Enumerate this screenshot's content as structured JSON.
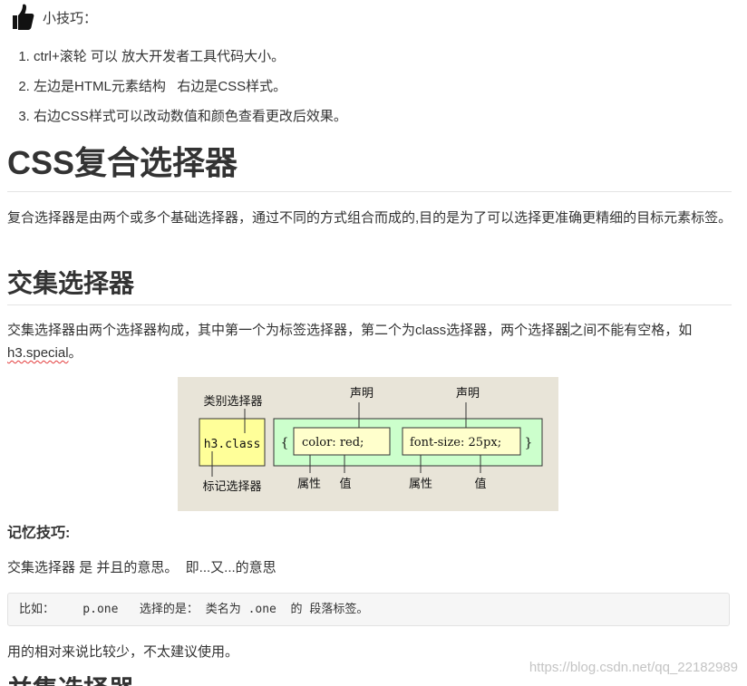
{
  "tip": {
    "icon": "thumbs-up-icon",
    "title": "小技巧："
  },
  "tips_list": [
    "ctrl+滚轮 可以 放大开发者工具代码大小。",
    "左边是HTML元素结构   右边是CSS样式。",
    "右边CSS样式可以改动数值和颜色查看更改后效果。"
  ],
  "section": {
    "title": "CSS复合选择器",
    "intro": "复合选择器是由两个或多个基础选择器，通过不同的方式组合而成的,目的是为了可以选择更准确更精细的目标元素标签。"
  },
  "intersection": {
    "title": "交集选择器",
    "desc_part1": "交集选择器由两个选择器构成，其中第一个为标签选择器，第二个为class选择器，两个选择器",
    "desc_part2": "之间不能有空格，如",
    "desc_code": "h3.special",
    "desc_end": "。"
  },
  "diagram": {
    "class_selector_label": "类别选择器",
    "tag_selector_label": "标记选择器",
    "selector_text": "h3.class",
    "open_brace": "{",
    "close_brace": "}",
    "declaration1": "color: red;",
    "declaration2": "font-size: 25px;",
    "statement_label1": "声明",
    "statement_label2": "声明",
    "property_label1": "属性",
    "value_label1": "值",
    "property_label2": "属性",
    "value_label2": "值",
    "colors": {
      "background": "#e8e4d8",
      "selector_fill": "#ffff99",
      "rule_fill": "#ccffcc",
      "decl_fill": "#ffffcc"
    }
  },
  "memo": {
    "title": "记忆技巧:",
    "text": "交集选择器 是 并且的意思。  即...又...的意思"
  },
  "code_example": "比如：    p.one   选择的是： 类名为 .one  的 段落标签。",
  "footer_text": "用的相对来说比较少，不太建议使用。",
  "next_heading": "并集选择器",
  "watermark": "https://blog.csdn.net/qq_22182989"
}
